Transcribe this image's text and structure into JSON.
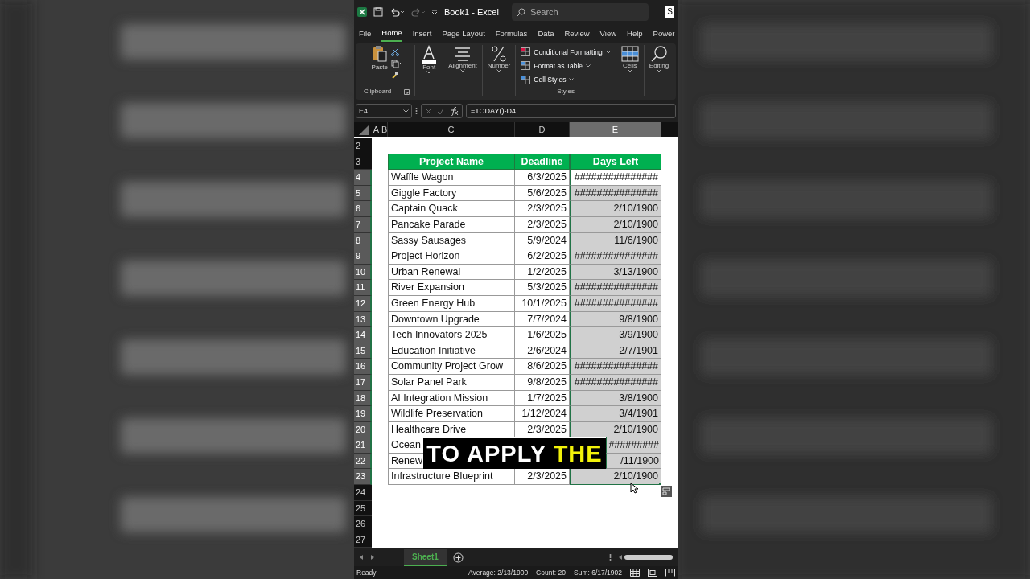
{
  "window": {
    "title": "Book1 - Excel",
    "search_placeholder": "Search",
    "share_button": "S"
  },
  "menu_tabs": [
    {
      "label": "File",
      "selected": false
    },
    {
      "label": "Home",
      "selected": true
    },
    {
      "label": "Insert",
      "selected": false
    },
    {
      "label": "Page Layout",
      "selected": false
    },
    {
      "label": "Formulas",
      "selected": false
    },
    {
      "label": "Data",
      "selected": false
    },
    {
      "label": "Review",
      "selected": false
    },
    {
      "label": "View",
      "selected": false
    },
    {
      "label": "Help",
      "selected": false
    },
    {
      "label": "Power",
      "selected": false
    }
  ],
  "ribbon": {
    "paste": "Paste",
    "clipboard": "Clipboard",
    "font": "Font",
    "alignment": "Alignment",
    "number": "Number",
    "styles_items": [
      "Conditional Formatting",
      "Format as Table",
      "Cell Styles"
    ],
    "styles": "Styles",
    "cells": "Cells",
    "editing": "Editing"
  },
  "formula_bar": {
    "name_box": "E4",
    "formula": "=TODAY()-D4"
  },
  "columns": [
    {
      "label": "A",
      "selected": false
    },
    {
      "label": "B",
      "selected": false
    },
    {
      "label": "C",
      "selected": false
    },
    {
      "label": "D",
      "selected": false
    },
    {
      "label": "E",
      "selected": true
    }
  ],
  "row_numbers": [
    {
      "label": "2",
      "selected": false
    },
    {
      "label": "3",
      "selected": false
    },
    {
      "label": "4",
      "selected": true
    },
    {
      "label": "5",
      "selected": true
    },
    {
      "label": "6",
      "selected": true
    },
    {
      "label": "7",
      "selected": true
    },
    {
      "label": "8",
      "selected": true
    },
    {
      "label": "9",
      "selected": true
    },
    {
      "label": "10",
      "selected": true
    },
    {
      "label": "11",
      "selected": true
    },
    {
      "label": "12",
      "selected": true
    },
    {
      "label": "13",
      "selected": true
    },
    {
      "label": "14",
      "selected": true
    },
    {
      "label": "15",
      "selected": true
    },
    {
      "label": "16",
      "selected": true
    },
    {
      "label": "17",
      "selected": true
    },
    {
      "label": "18",
      "selected": true
    },
    {
      "label": "19",
      "selected": true
    },
    {
      "label": "20",
      "selected": true
    },
    {
      "label": "21",
      "selected": true
    },
    {
      "label": "22",
      "selected": true
    },
    {
      "label": "23",
      "selected": true
    },
    {
      "label": "24",
      "selected": false
    },
    {
      "label": "25",
      "selected": false
    },
    {
      "label": "26",
      "selected": false
    },
    {
      "label": "27",
      "selected": false
    }
  ],
  "table": {
    "headers": [
      "Project Name",
      "Deadline",
      "Days Left"
    ],
    "rows": [
      {
        "name": "Waffle Wagon",
        "deadline": "6/3/2025",
        "days_left": "###############",
        "selected": true,
        "active": true
      },
      {
        "name": "Giggle Factory",
        "deadline": "5/6/2025",
        "days_left": "###############",
        "selected": true,
        "active": false
      },
      {
        "name": "Captain Quack",
        "deadline": "2/3/2025",
        "days_left": "2/10/1900",
        "selected": true,
        "active": false
      },
      {
        "name": "Pancake Parade",
        "deadline": "2/3/2025",
        "days_left": "2/10/1900",
        "selected": true,
        "active": false
      },
      {
        "name": "Sassy Sausages",
        "deadline": "5/9/2024",
        "days_left": "11/6/1900",
        "selected": true,
        "active": false
      },
      {
        "name": "Project Horizon",
        "deadline": "6/2/2025",
        "days_left": "###############",
        "selected": true,
        "active": false
      },
      {
        "name": "Urban Renewal",
        "deadline": "1/2/2025",
        "days_left": "3/13/1900",
        "selected": true,
        "active": false
      },
      {
        "name": "River Expansion",
        "deadline": "5/3/2025",
        "days_left": "###############",
        "selected": true,
        "active": false
      },
      {
        "name": "Green Energy Hub",
        "deadline": "10/1/2025",
        "days_left": "###############",
        "selected": true,
        "active": false
      },
      {
        "name": "Downtown Upgrade",
        "deadline": "7/7/2024",
        "days_left": "9/8/1900",
        "selected": true,
        "active": false
      },
      {
        "name": "Tech Innovators 2025",
        "deadline": "1/6/2025",
        "days_left": "3/9/1900",
        "selected": true,
        "active": false
      },
      {
        "name": "Education Initiative",
        "deadline": "2/6/2024",
        "days_left": "2/7/1901",
        "selected": true,
        "active": false
      },
      {
        "name": "Community Project Grow",
        "deadline": "8/6/2025",
        "days_left": "###############",
        "selected": true,
        "active": false
      },
      {
        "name": "Solar Panel Park",
        "deadline": "9/8/2025",
        "days_left": "###############",
        "selected": true,
        "active": false
      },
      {
        "name": "AI Integration Mission",
        "deadline": "1/7/2025",
        "days_left": "3/8/1900",
        "selected": true,
        "active": false
      },
      {
        "name": "Wildlife Preservation",
        "deadline": "1/12/2024",
        "days_left": "3/4/1901",
        "selected": true,
        "active": false
      },
      {
        "name": "Healthcare Drive",
        "deadline": "2/3/2025",
        "days_left": "2/10/1900",
        "selected": true,
        "active": false
      },
      {
        "name": "Ocean",
        "days_left": "#########",
        "selected": true,
        "active": false
      },
      {
        "name": "Renew",
        "days_left": "/11/1900",
        "selected": true,
        "active": false
      },
      {
        "name": "Infrastructure Blueprint",
        "deadline": "2/3/2025",
        "days_left": "2/10/1900",
        "selected": true,
        "active": false
      }
    ]
  },
  "caption": [
    {
      "text": "TO APPLY",
      "highlight": false
    },
    {
      "text": "THE",
      "highlight": true
    }
  ],
  "sheet_tabs": [
    {
      "label": "Sheet1",
      "selected": true
    }
  ],
  "status_bar": {
    "state": "Ready",
    "stats": [
      "Average: 2/13/1900",
      "Count: 20",
      "Sum: 6/17/1902"
    ]
  }
}
